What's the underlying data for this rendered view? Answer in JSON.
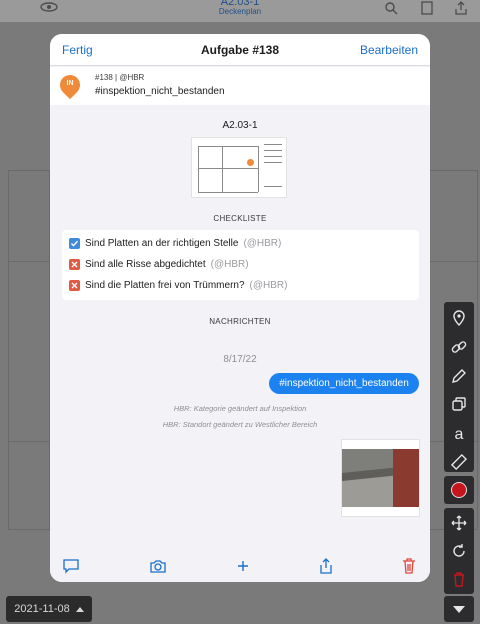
{
  "background": {
    "doc_title": "A2.03-1",
    "doc_subtitle": "Deckenplan",
    "date_chip": "2021-11-08",
    "colors": {
      "record": "#c4161c"
    },
    "toolbar_icons": [
      "pin-icon",
      "link-icon",
      "pencil-icon",
      "copy-icon",
      "text-icon",
      "ruler-icon",
      "record-icon",
      "move-icon",
      "rotate-icon",
      "trash-icon",
      "chevron-down-icon"
    ]
  },
  "modal": {
    "header": {
      "left": "Fertig",
      "title": "Aufgabe #138",
      "right": "Bearbeiten"
    },
    "task": {
      "badge": "IN",
      "meta": "#138 | @HBR",
      "tag": "#inspektion_nicht_bestanden",
      "badge_color": "#f08a3b"
    },
    "sheet": "A2.03-1",
    "checklist": {
      "heading": "CHECKLISTE",
      "items": [
        {
          "text": "Sind Platten an der richtigen Stelle",
          "by": "(@HBR)",
          "checked": true
        },
        {
          "text": "Sind alle Risse abgedichtet",
          "by": "(@HBR)",
          "checked": false
        },
        {
          "text": "Sind die Platten frei von Trümmern?",
          "by": "(@HBR)",
          "checked": false
        }
      ]
    },
    "messages": {
      "heading": "NACHRICHTEN",
      "date": "8/17/22",
      "bubble": "#inspektion_nicht_bestanden",
      "system": [
        "HBR: Kategorie geändert auf Inspektion",
        "HBR: Standort geändert zu Westlicher Bereich"
      ],
      "bubble_color": "#1c82f0"
    },
    "footer_icons": [
      "comment-icon",
      "camera-icon",
      "plus-icon",
      "share-icon",
      "trash-icon"
    ],
    "colors": {
      "link": "#1a6fc9",
      "check_ok": "#3d8bd9",
      "check_fail": "#e05a43",
      "delete": "#e0453a"
    }
  }
}
